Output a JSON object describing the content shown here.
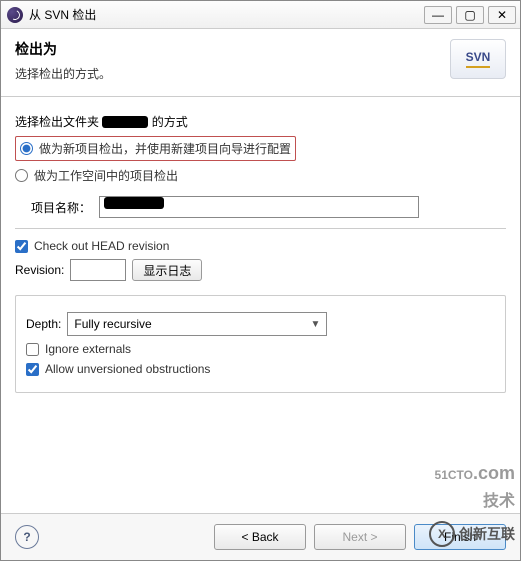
{
  "titlebar": {
    "title": "从 SVN 检出",
    "minimize": "—",
    "maximize": "▢",
    "close": "✕"
  },
  "header": {
    "heading": "检出为",
    "subtext": "选择检出的方式。",
    "logo": "SVN"
  },
  "body": {
    "method_label_prefix": "选择检出文件夹",
    "method_label_suffix": "的方式",
    "radio1": "做为新项目检出，并使用新建项目向导进行配置",
    "radio2": "做为工作空间中的项目检出",
    "radio_selected": 1,
    "project_name_label": "项目名称：",
    "project_name_value": "",
    "head_checkbox": "Check out HEAD revision",
    "head_checked": true,
    "revision_label": "Revision:",
    "revision_value": "",
    "show_log_btn": "显示日志",
    "depth_label": "Depth:",
    "depth_value": "Fully recursive",
    "ignore_externals": "Ignore externals",
    "ignore_externals_checked": false,
    "allow_unversioned": "Allow unversioned obstructions",
    "allow_unversioned_checked": true
  },
  "footer": {
    "help": "?",
    "back": "< Back",
    "next": "Next >",
    "finish": "Finish"
  },
  "watermarks": {
    "w1_main": "51CTO",
    "w1_sub": ".com",
    "w1_tag": "技术",
    "w2_glyph": "X",
    "w2_text": "创新互联"
  }
}
